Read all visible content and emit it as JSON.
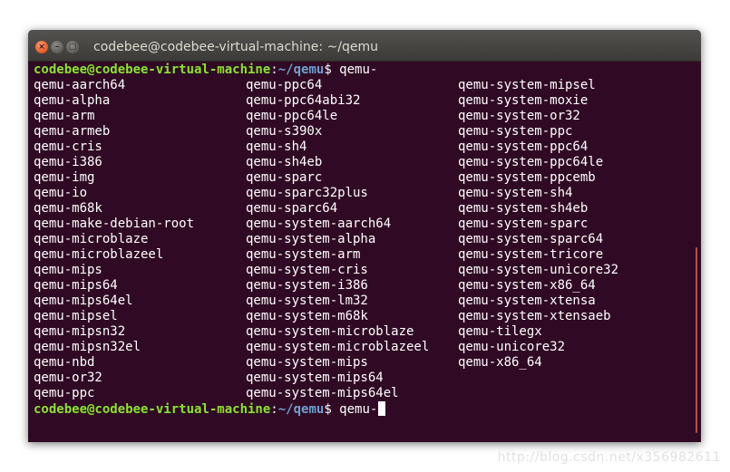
{
  "window": {
    "title": "codebee@codebee-virtual-machine: ~/qemu",
    "buttons": {
      "close": "×",
      "minimize": "–",
      "maximize": "□"
    }
  },
  "prompt": {
    "user_host": "codebee@codebee-virtual-machine",
    "colon": ":",
    "path": "~/qemu",
    "symbol": "$ ",
    "command": "qemu-"
  },
  "completions": {
    "col1": [
      "qemu-aarch64",
      "qemu-alpha",
      "qemu-arm",
      "qemu-armeb",
      "qemu-cris",
      "qemu-i386",
      "qemu-img",
      "qemu-io",
      "qemu-m68k",
      "qemu-make-debian-root",
      "qemu-microblaze",
      "qemu-microblazeel",
      "qemu-mips",
      "qemu-mips64",
      "qemu-mips64el",
      "qemu-mipsel",
      "qemu-mipsn32",
      "qemu-mipsn32el",
      "qemu-nbd",
      "qemu-or32",
      "qemu-ppc"
    ],
    "col2": [
      "qemu-ppc64",
      "qemu-ppc64abi32",
      "qemu-ppc64le",
      "qemu-s390x",
      "qemu-sh4",
      "qemu-sh4eb",
      "qemu-sparc",
      "qemu-sparc32plus",
      "qemu-sparc64",
      "qemu-system-aarch64",
      "qemu-system-alpha",
      "qemu-system-arm",
      "qemu-system-cris",
      "qemu-system-i386",
      "qemu-system-lm32",
      "qemu-system-m68k",
      "qemu-system-microblaze",
      "qemu-system-microblazeel",
      "qemu-system-mips",
      "qemu-system-mips64",
      "qemu-system-mips64el"
    ],
    "col3": [
      "qemu-system-mipsel",
      "qemu-system-moxie",
      "qemu-system-or32",
      "qemu-system-ppc",
      "qemu-system-ppc64",
      "qemu-system-ppc64le",
      "qemu-system-ppcemb",
      "qemu-system-sh4",
      "qemu-system-sh4eb",
      "qemu-system-sparc",
      "qemu-system-sparc64",
      "qemu-system-tricore",
      "qemu-system-unicore32",
      "qemu-system-x86_64",
      "qemu-system-xtensa",
      "qemu-system-xtensaeb",
      "qemu-tilegx",
      "qemu-unicore32",
      "qemu-x86_64"
    ]
  },
  "watermark": "http://blog.csdn.net/x356982611",
  "colors": {
    "terminal_bg": "#300a24",
    "prompt_user": "#8ae234",
    "prompt_path": "#729fcf",
    "text": "#ffffff",
    "close_button": "#e2561f"
  }
}
